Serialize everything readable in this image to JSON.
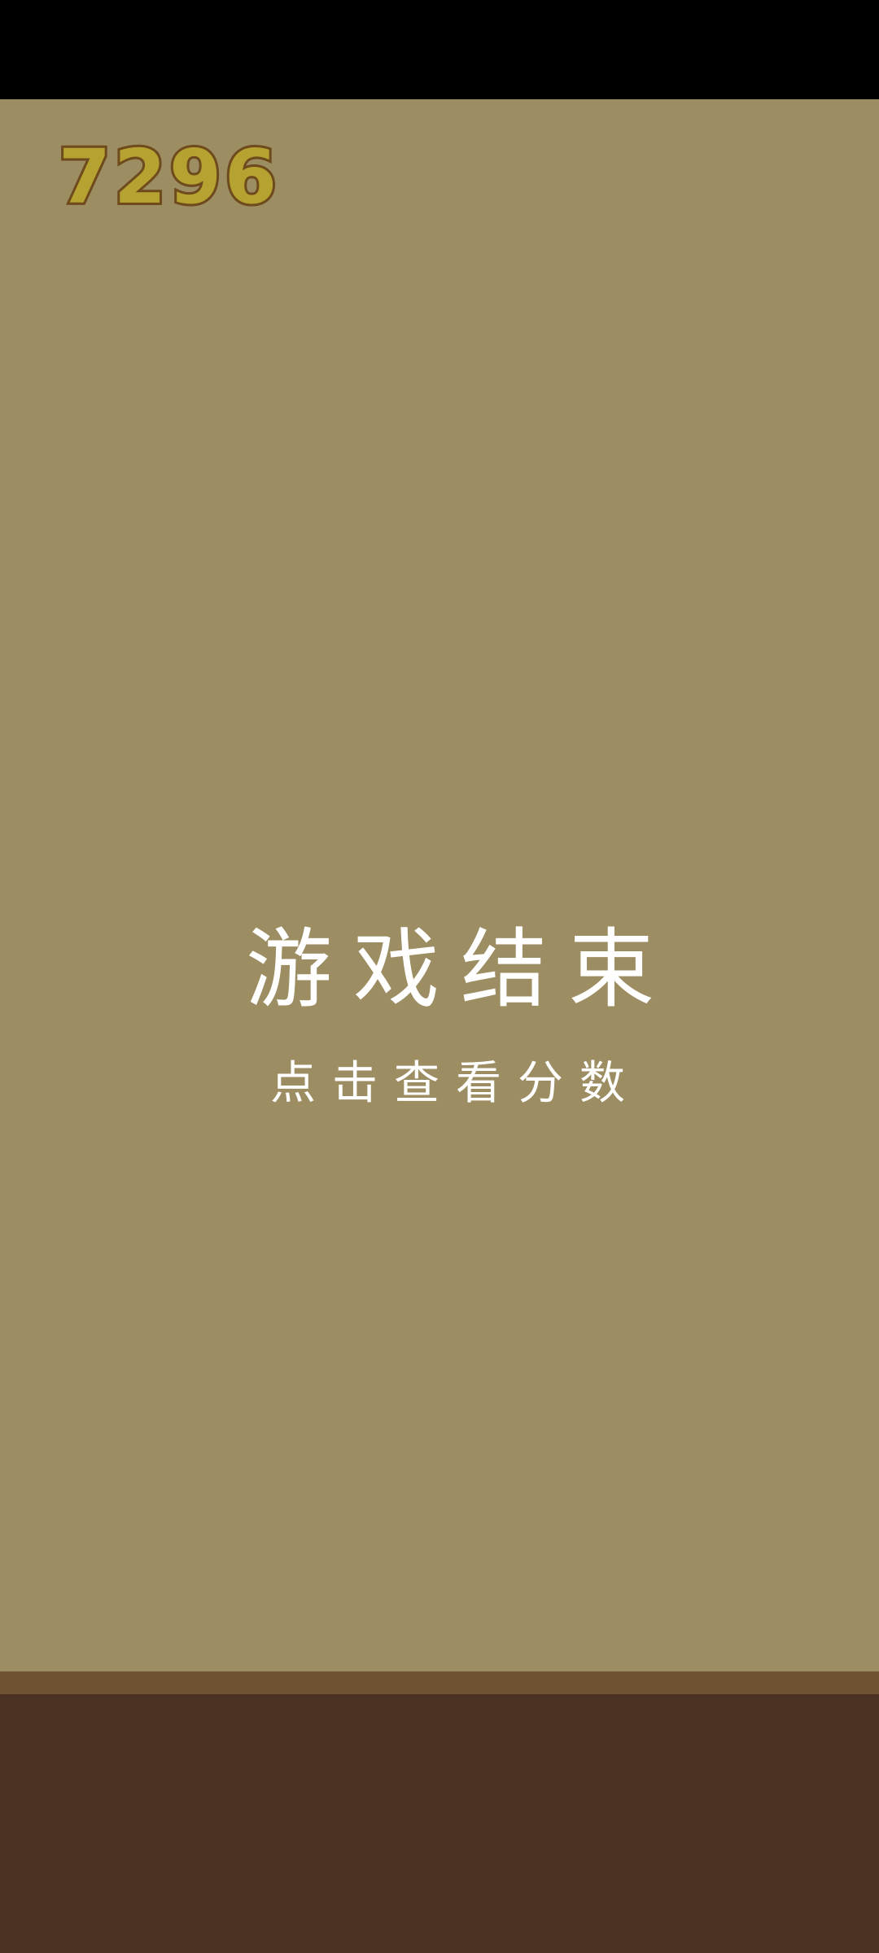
{
  "game": {
    "score": "7296",
    "game_over_title": "游戏结束",
    "tap_hint": "点击查看分数"
  },
  "colors": {
    "background": "#9c8d62",
    "ground_edge": "#6f5232",
    "ground": "#4a3122",
    "score_fill": "#b5a230",
    "score_outline": "#6e4a1c",
    "overlay_text": "#ffffff"
  }
}
